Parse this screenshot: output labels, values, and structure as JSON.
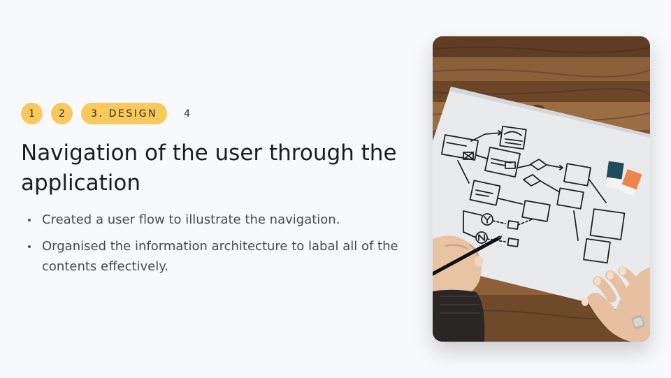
{
  "steps": [
    {
      "label": "1",
      "active": false
    },
    {
      "label": "2",
      "active": false
    },
    {
      "label": "3. DESIGN",
      "active": true
    },
    {
      "label": "4",
      "active": false
    }
  ],
  "title": "Navigation of the user through the application",
  "bullets": [
    "Created a user flow to illustrate the navigation.",
    "Organised the information architecture to labal all of the contents effectively."
  ],
  "colors": {
    "accent": "#f9c95c",
    "background": "#f8f9fb",
    "title": "#1c1c1c",
    "body_text": "#4a4a4a"
  },
  "image": {
    "subject": "hand sketching user flow diagram on paper over wooden table"
  }
}
